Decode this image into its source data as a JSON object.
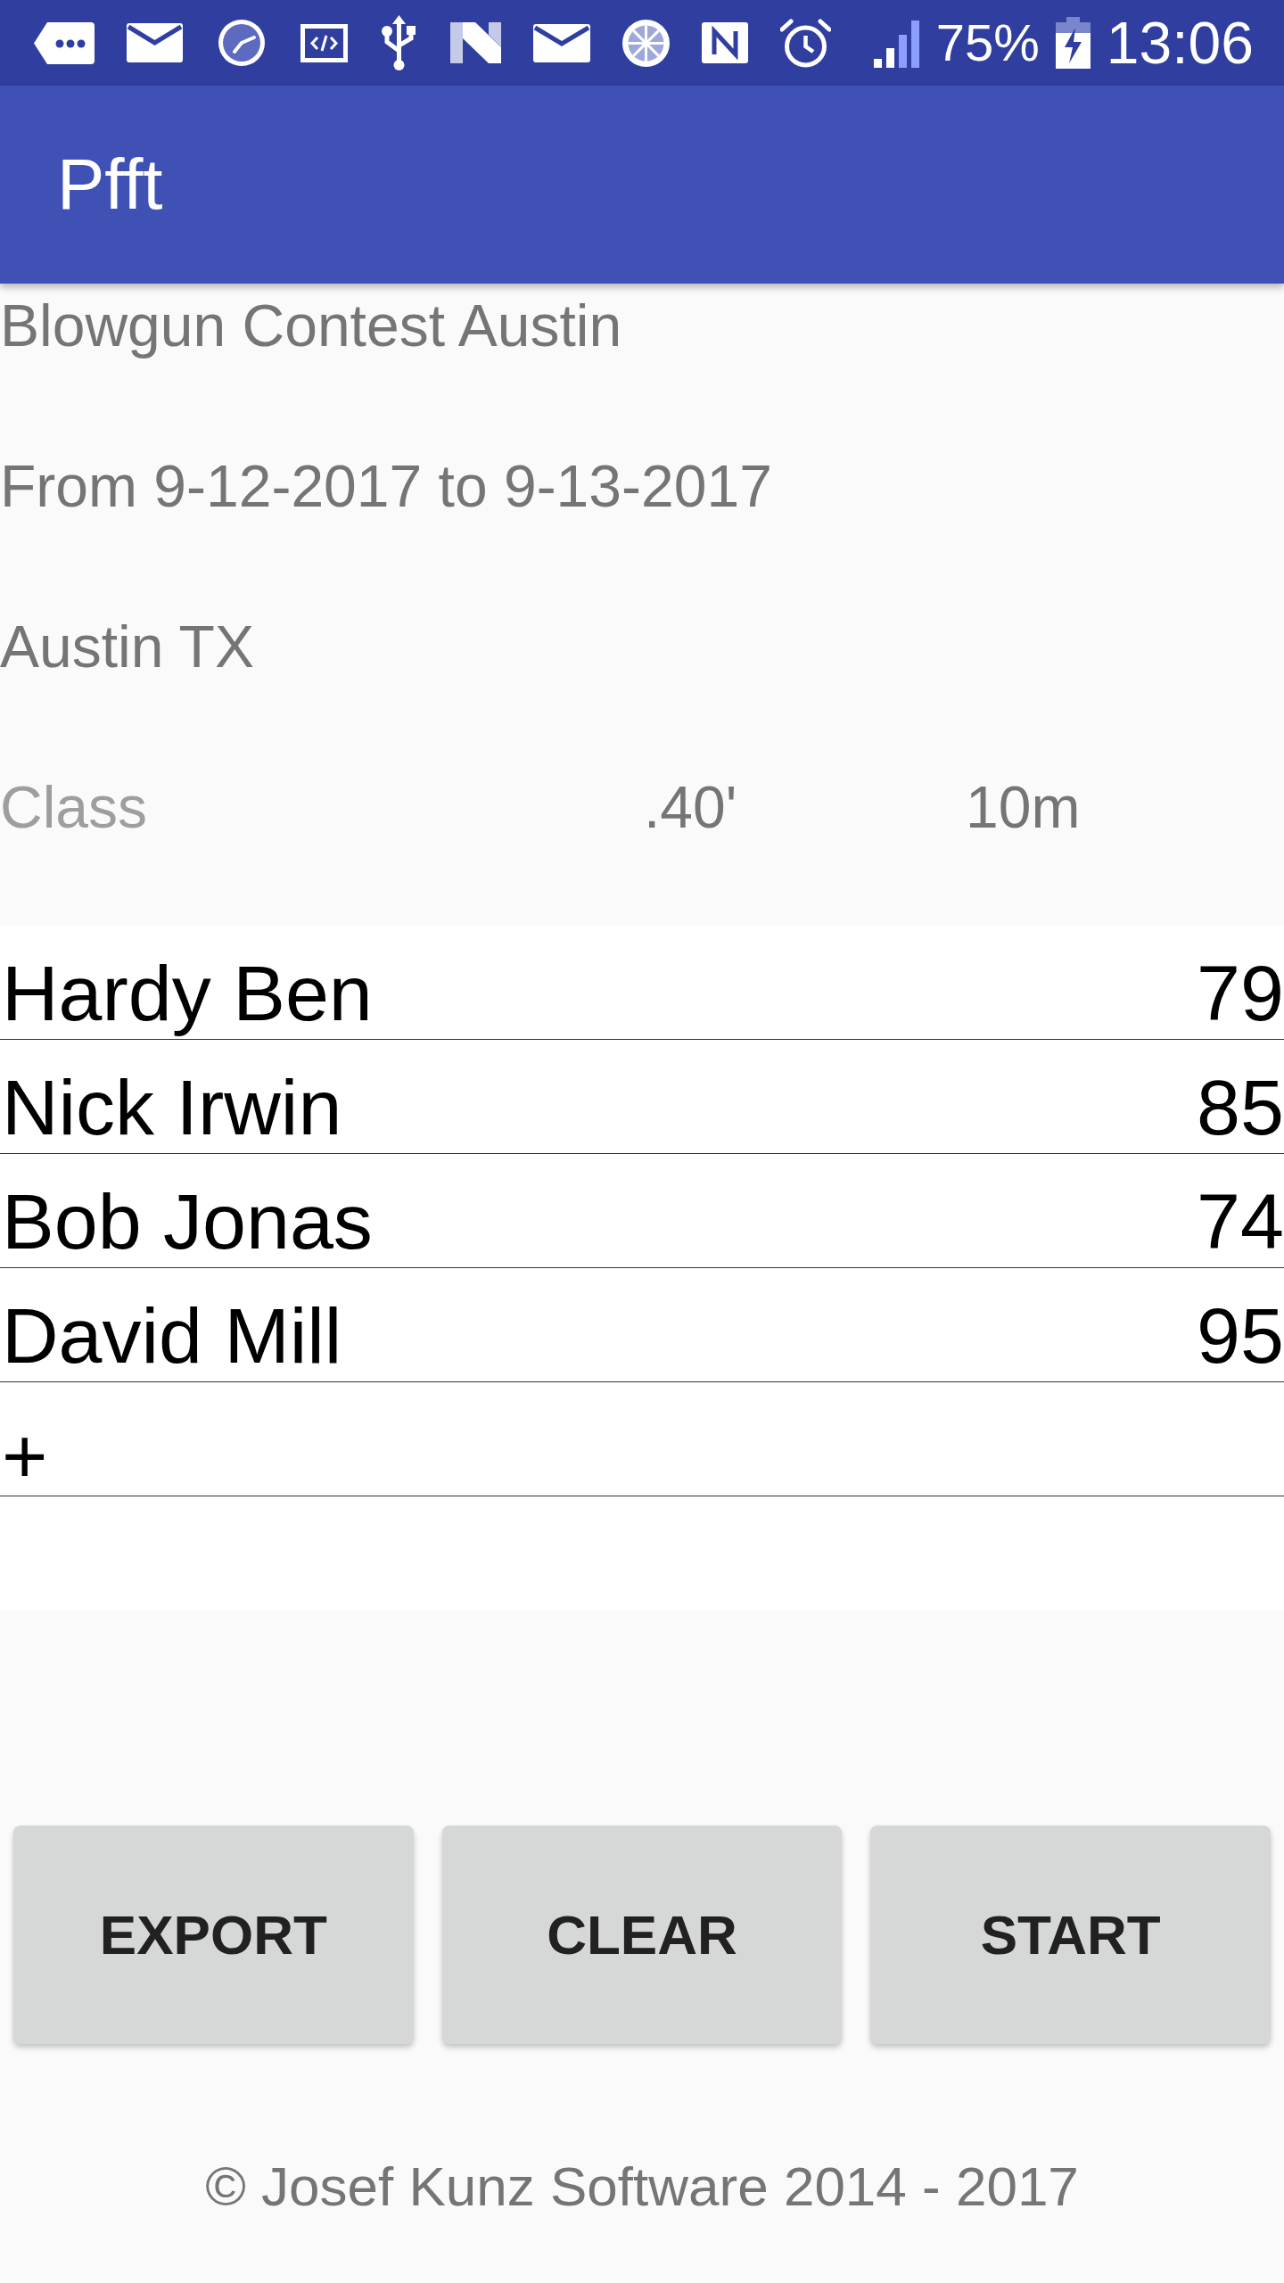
{
  "status_bar": {
    "battery": "75%",
    "time": "13:06"
  },
  "app_bar": {
    "title": "Pfft"
  },
  "event": {
    "name": "Blowgun Contest Austin",
    "dates": "From 9-12-2017 to 9-13-2017",
    "location": "Austin TX"
  },
  "class_row": {
    "label": "Class",
    "column_2": ".40'",
    "column_3": "10m"
  },
  "participants": [
    {
      "name": "Hardy Ben",
      "score": "79"
    },
    {
      "name": "Nick Irwin",
      "score": "85"
    },
    {
      "name": "Bob Jonas",
      "score": "74"
    },
    {
      "name": "David Mill",
      "score": "95"
    }
  ],
  "add_row": {
    "label": "+"
  },
  "buttons": [
    "EXPORT",
    "CLEAR",
    "START"
  ],
  "footer": "© Josef Kunz Software 2014 - 2017"
}
